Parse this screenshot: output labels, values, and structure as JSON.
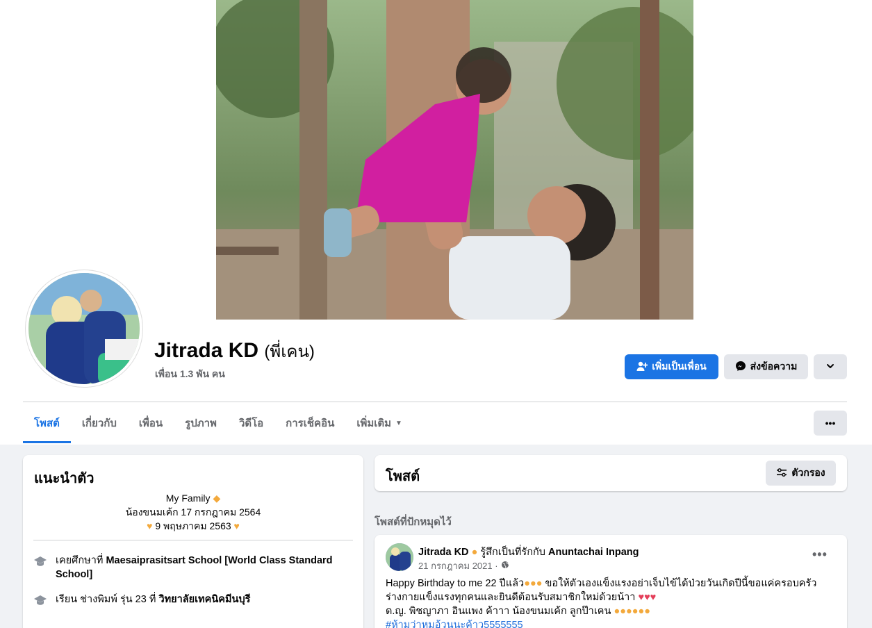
{
  "profile": {
    "name": "Jitrada KD",
    "alt_name": "(พี่เคน)",
    "friends": "เพื่อน 1.3 พัน คน"
  },
  "actions": {
    "add_friend": "เพิ่มเป็นเพื่อน",
    "message": "ส่งข้อความ",
    "more_icon": "chevron-down-icon"
  },
  "tabs": [
    {
      "label": "โพสต์",
      "active": true
    },
    {
      "label": "เกี่ยวกับ"
    },
    {
      "label": "เพื่อน"
    },
    {
      "label": "รูปภาพ"
    },
    {
      "label": "วิดีโอ"
    },
    {
      "label": "การเช็คอิน"
    },
    {
      "label": "เพิ่มเติม"
    }
  ],
  "intro": {
    "title": "แนะนำตัว",
    "bio_line1": "My Family",
    "bio_line2": "น้องขนมเค้ก 17 กรกฎาคม 2564",
    "bio_line3": "9 พฤษภาคม 2563",
    "edu1_prefix": "เคยศึกษาที่",
    "edu1_school": "Maesaiprasitsart School [World Class Standard School]",
    "edu2_prefix": "เรียน ช่างพิมพ์ รุ่น 23 ที่",
    "edu2_school": "วิทยาลัยเทคนิคมีนบุรี"
  },
  "posts": {
    "title": "โพสต์",
    "filter_label": "ตัวกรอง",
    "pinned_label": "โพสต์ที่ปักหมุดไว้"
  },
  "post": {
    "author": "Jitrada KD",
    "feeling": "รู้สึกเป็นที่รักกับ",
    "tagged": "Anuntachai Inpang",
    "date": "21 กรกฎาคม 2021 ·",
    "line1": "Happy Birthday to me 22 ปีแล้ว",
    "line1b": "ขอให้ตัวเองแข็งแรงอย่าเจ็บไข้ได้ป่วยวันเกิดปีนี้ขอแค่ครอบครัว",
    "line2": "ร่างกายแข็งแรงทุกคนและยินดีต้อนรับสมาชิกใหม่ด้วยน้าา",
    "line3": "ด.ญ. พิชญาภา อินแพง ค้าาา น้องขนมเค้ก ลูกป๊าเคน",
    "hashtag": "#ห้ามว่าหมอ้วนนะค้าว5555555"
  },
  "colors": {
    "primary": "#1b74e4",
    "bg": "#f0f2f5",
    "muted": "#65676b"
  }
}
